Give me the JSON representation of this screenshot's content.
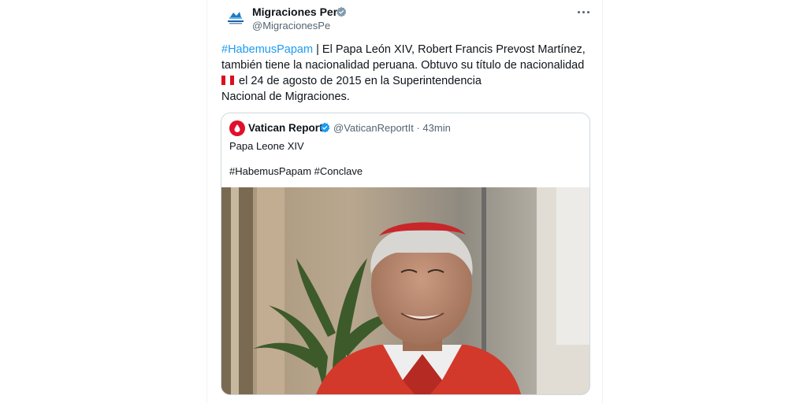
{
  "tweet": {
    "author_name": "Migraciones Perú",
    "author_handle": "@MigracionesPe",
    "avatar_icon": "migraciones-logo",
    "verified_icon": "grey-verified-badge",
    "more_icon": "more-options",
    "hashtag": "#HabemusPapam",
    "line1_rest": " | El Papa León XIV, Robert Francis Prevost Martínez,",
    "line2": "también tiene la nacionalidad peruana. Obtuvo su título de nacionalidad",
    "line3": "el 24 de agosto de 2015 en la Superintendencia",
    "line4": "Nacional de Migraciones.",
    "flag_colors": [
      "#d91023",
      "#ffffff",
      "#d91023"
    ]
  },
  "quote": {
    "author_name": "Vatican Report",
    "author_handle": "@VaticanReportIt",
    "separator": " · ",
    "time": "43min",
    "text1": "Papa Leone XIV",
    "text2": "#HabemusPapam #Conclave",
    "verified_icon": "blue-verified-badge",
    "photo_desc": "cardinal-portrait"
  },
  "colors": {
    "link": "#1d9bf0",
    "secondary": "#536471",
    "verified_blue": "#1d9bf0"
  }
}
